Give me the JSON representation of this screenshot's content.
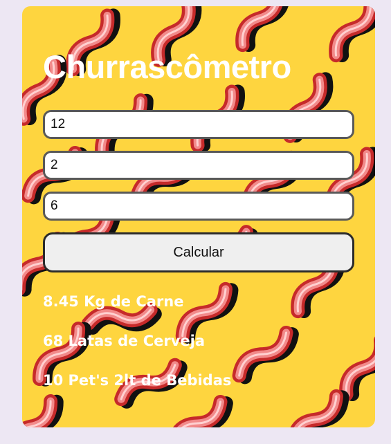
{
  "app": {
    "title": "Churrascômetro"
  },
  "inputs": [
    {
      "value": "12"
    },
    {
      "value": "2"
    },
    {
      "value": "6"
    }
  ],
  "button": {
    "label": "Calcular"
  },
  "results": [
    "8.45 Kg de Carne",
    "68 Latas de Cerveja",
    "10 Pet's 2lt de Bebidas"
  ],
  "colors": {
    "page_background": "#ede7f3",
    "card_background": "#fed53f",
    "text": "#ffffff",
    "bacon_outer": "#c62a2a",
    "bacon_inner": "#f28a8a",
    "bacon_shadow": "#111111"
  },
  "decoration": "bacon-pattern"
}
